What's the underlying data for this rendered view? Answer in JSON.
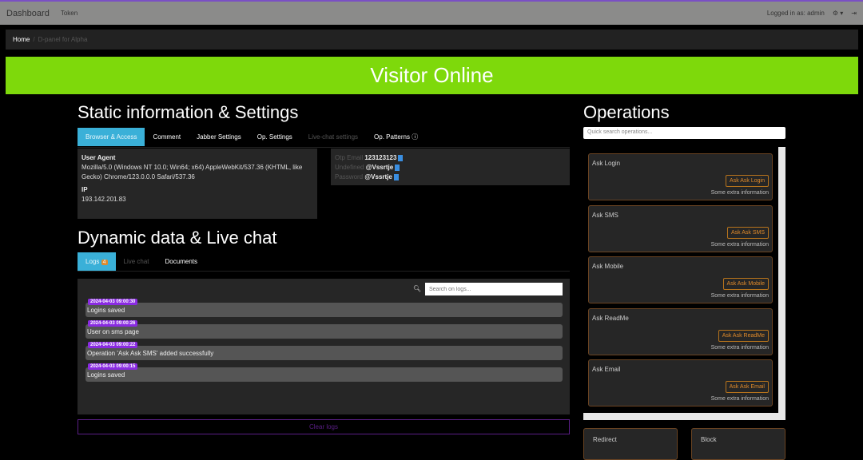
{
  "nav": {
    "brand": "Dashboard",
    "token": "Token",
    "logged": "Logged in as: admin",
    "gear": "gear-icon",
    "logout": "logout-icon"
  },
  "breadcrumb": {
    "home": "Home",
    "sep": "/",
    "current": "D-panel for Alpha"
  },
  "banner": "Visitor Online",
  "static": {
    "title": "Static information & Settings",
    "tabs": [
      {
        "label": "Browser & Access"
      },
      {
        "label": "Comment"
      },
      {
        "label": "Jabber Settings"
      },
      {
        "label": "Op. Settings"
      },
      {
        "label": "Live-chat settings"
      },
      {
        "label": "Op. Patterns"
      }
    ],
    "ua_label": "User Agent",
    "ua": "Mozilla/5.0 (Windows NT 10.0; Win64; x64) AppleWebKit/537.36 (KHTML, like Gecko) Chrome/123.0.0.0 Safari/537.36",
    "ip_label": "IP",
    "ip": "193.142.201.83",
    "fields": [
      {
        "label": "Otp Email",
        "value": "123123123"
      },
      {
        "label": "Undefined",
        "value": "@Vssrtje"
      },
      {
        "label": "Password",
        "value": "@Vssrtje"
      }
    ]
  },
  "dynamic": {
    "title": "Dynamic data & Live chat",
    "tabs": [
      {
        "label": "Logs",
        "badge": "4"
      },
      {
        "label": "Live chat"
      },
      {
        "label": "Documents"
      }
    ],
    "search_placeholder": "Search on logs...",
    "logs": [
      {
        "time": "2024-04-03 09:00:30",
        "text": "Logins saved"
      },
      {
        "time": "2024-04-03 09:00:26",
        "text": "User on sms page"
      },
      {
        "time": "2024-04-03 09:00:22",
        "text": "Operation 'Ask Ask SMS' added successfully"
      },
      {
        "time": "2024-04-03 09:00:15",
        "text": "Logins saved"
      }
    ],
    "clear": "Clear logs"
  },
  "operations": {
    "title": "Operations",
    "search_placeholder": "Quick search operations...",
    "items": [
      {
        "title": "Ask Login",
        "button": "Ask Ask Login",
        "info": "Some extra information"
      },
      {
        "title": "Ask SMS",
        "button": "Ask Ask SMS",
        "info": "Some extra information"
      },
      {
        "title": "Ask Mobile",
        "button": "Ask Ask Mobile",
        "info": "Some extra information"
      },
      {
        "title": "Ask ReadMe",
        "button": "Ask Ask ReadMe",
        "info": "Some extra information"
      },
      {
        "title": "Ask Email",
        "button": "Ask Ask Email",
        "info": "Some extra information"
      }
    ],
    "redirect": "Redirect",
    "block": "Block"
  },
  "colors": {
    "banner": "#7ed90b",
    "tab_active": "#3ab0d8",
    "timestamp": "#8a2be2",
    "op_button": "#e08a2a"
  }
}
